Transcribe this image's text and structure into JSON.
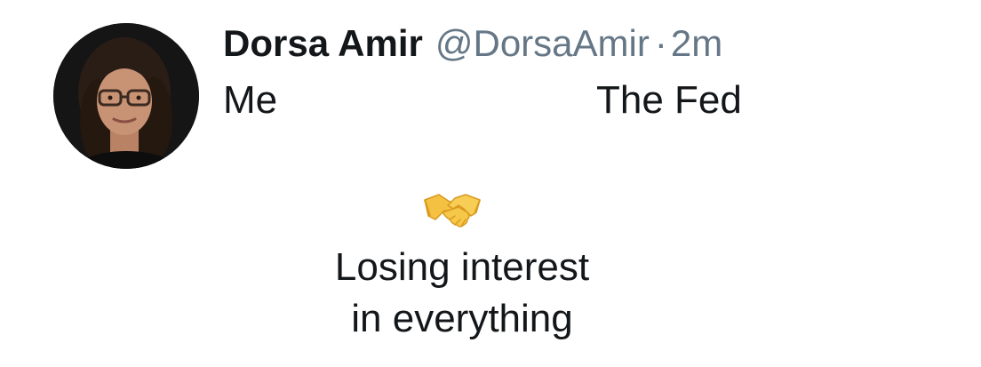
{
  "tweet": {
    "author": {
      "display_name": "Dorsa Amir",
      "handle": "@DorsaAmir",
      "separator": "·",
      "time": "2m",
      "avatar_icon": "profile-photo"
    },
    "body": {
      "left_label": "Me",
      "right_label": "The Fed",
      "emoji_icon": "handshake-icon",
      "caption_line1": "Losing interest",
      "caption_line2": "in everything"
    }
  },
  "colors": {
    "text_primary": "#14171a",
    "text_secondary": "#657786",
    "background": "#ffffff",
    "emoji_yellow": "#f5c142"
  }
}
